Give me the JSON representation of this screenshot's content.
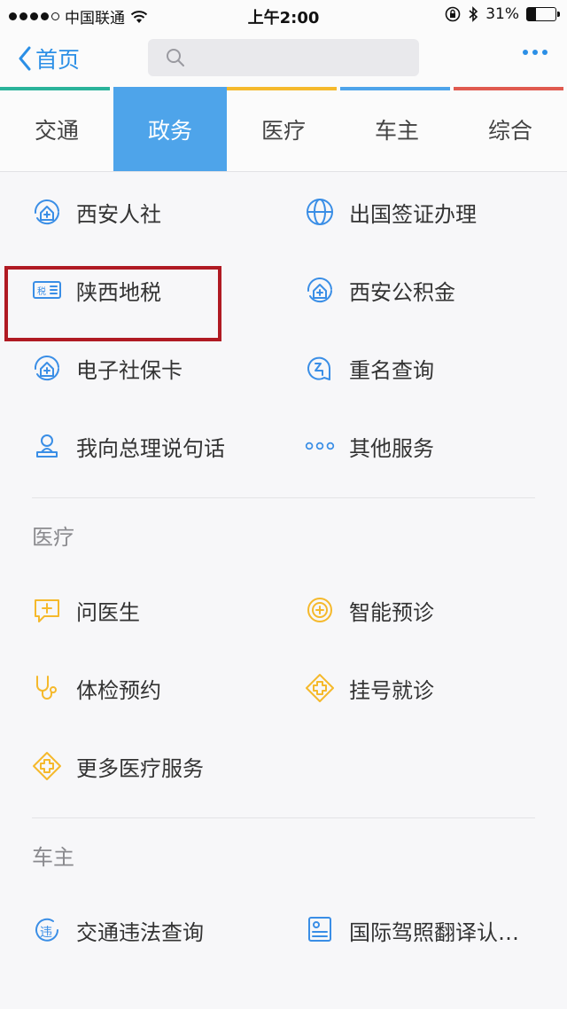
{
  "status": {
    "carrier": "中国联通",
    "time": "上午2:00",
    "battery_text": "31%",
    "battery_level": 0.31
  },
  "nav": {
    "back_label": "首页",
    "search_placeholder": ""
  },
  "tabs": [
    {
      "label": "交通",
      "color": "#2ab39a"
    },
    {
      "label": "政务",
      "color": "#3a8ee6"
    },
    {
      "label": "医疗",
      "color": "#f5b92c"
    },
    {
      "label": "车主",
      "color": "#4ea4ea"
    },
    {
      "label": "综合",
      "color": "#e05a4f"
    }
  ],
  "active_tab": 1,
  "gov": {
    "items": [
      {
        "label": "西安人社",
        "icon": "social-security-house-icon"
      },
      {
        "label": "出国签证办理",
        "icon": "globe-icon"
      },
      {
        "label": "陕西地税",
        "icon": "tax-card-icon"
      },
      {
        "label": "西安公积金",
        "icon": "housing-fund-icon"
      },
      {
        "label": "电子社保卡",
        "icon": "social-card-house-icon"
      },
      {
        "label": "重名查询",
        "icon": "name-search-icon"
      },
      {
        "label": "我向总理说句话",
        "icon": "person-stamp-icon"
      },
      {
        "label": "其他服务",
        "icon": "more-dots-icon"
      }
    ]
  },
  "medical": {
    "title": "医疗",
    "items": [
      {
        "label": "问医生",
        "icon": "chat-plus-icon"
      },
      {
        "label": "智能预诊",
        "icon": "smart-diagnosis-icon"
      },
      {
        "label": "体检预约",
        "icon": "stethoscope-icon"
      },
      {
        "label": "挂号就诊",
        "icon": "medical-cross-icon"
      },
      {
        "label": "更多医疗服务",
        "icon": "medical-cross-icon"
      }
    ]
  },
  "car": {
    "title": "车主",
    "items": [
      {
        "label": "交通违法查询",
        "icon": "violation-icon"
      },
      {
        "label": "国际驾照翻译认…",
        "icon": "license-doc-icon"
      }
    ]
  },
  "colors": {
    "blue": "#3a8ee6",
    "yellow": "#f5b92c",
    "highlight": "#b01a23"
  }
}
